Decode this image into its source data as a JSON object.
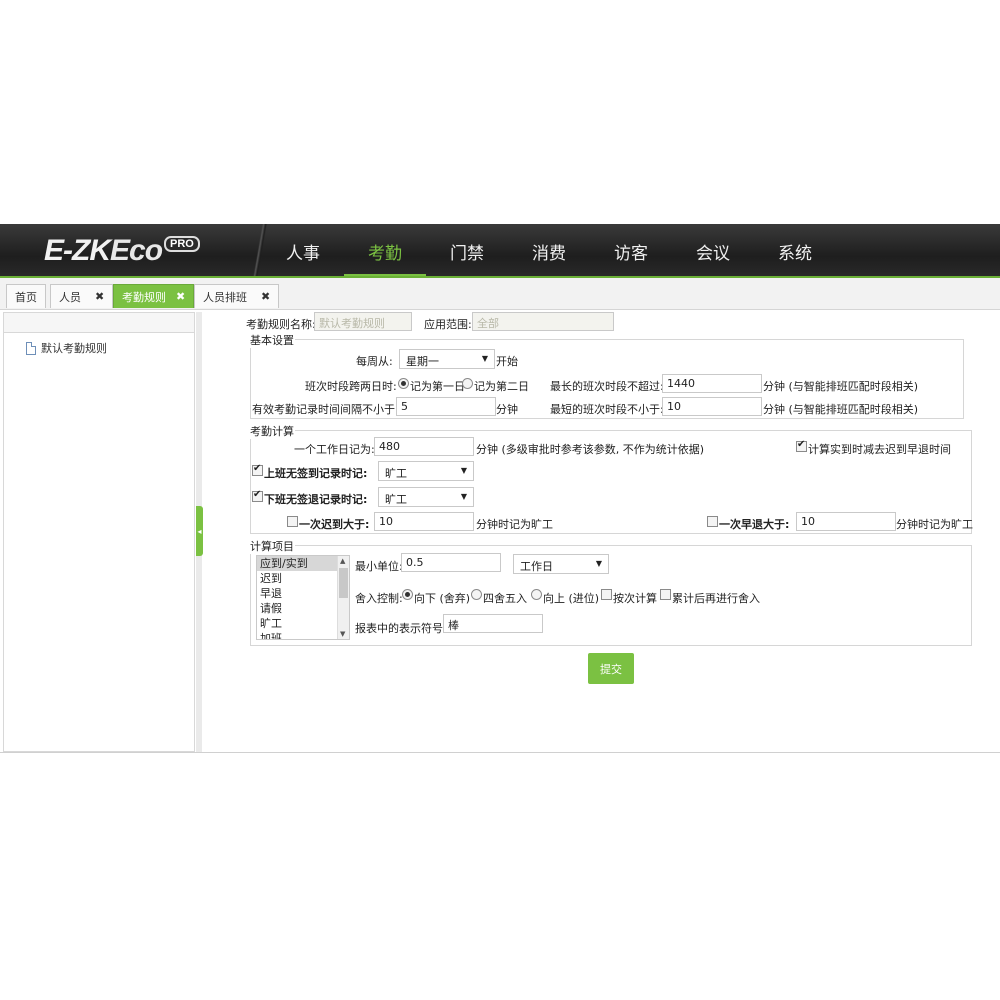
{
  "brand": {
    "logo_main": "E-ZK",
    "logo_eco": "Eco",
    "logo_badge": "PRO"
  },
  "nav": [
    "人事",
    "考勤",
    "门禁",
    "消费",
    "访客",
    "会议",
    "系统"
  ],
  "tabs": [
    {
      "label": "首页"
    },
    {
      "label": "人员",
      "close": "✖"
    },
    {
      "label": "考勤规则",
      "close": "✖"
    },
    {
      "label": "人员排班",
      "close": "✖"
    }
  ],
  "tree": {
    "node": "默认考勤规则"
  },
  "colors": {
    "accent": "#7bc142",
    "header_bg": "#2a2a2a"
  },
  "rule": {
    "name_label": "考勤规则名称:",
    "name_value": "默认考勤规则",
    "scope_label": "应用范围:",
    "scope_value": "全部"
  },
  "basic": {
    "legend": "基本设置",
    "week_label": "每周从:",
    "week_value": "星期一",
    "week_suffix": "开始",
    "cross_label": "班次时段跨两日时:",
    "cross_opt1": "记为第一日",
    "cross_opt2": "记为第二日",
    "maxshift_label": "最长的班次时段不超过:",
    "maxshift_value": "1440",
    "maxshift_suffix": "分钟 (与智能排班匹配时段相关)",
    "interval_label": "有效考勤记录时间间隔不小于:",
    "interval_value": "5",
    "interval_suffix": "分钟",
    "minshift_label": "最短的班次时段不小于:",
    "minshift_value": "10",
    "minshift_suffix": "分钟 (与智能排班匹配时段相关)"
  },
  "calc": {
    "legend": "考勤计算",
    "workday_label": "一个工作日记为:",
    "workday_value": "480",
    "workday_suffix": "分钟 (多级审批时参考该参数, 不作为统计依据)",
    "deduct_label": "计算实到时减去迟到早退时间",
    "nocheckin_label": "上班无签到记录时记:",
    "nocheckin_value": "旷工",
    "nocheckout_label": "下班无签退记录时记:",
    "nocheckout_value": "旷工",
    "late_label": "一次迟到大于:",
    "late_value": "10",
    "late_suffix": "分钟时记为旷工",
    "early_label": "一次早退大于:",
    "early_value": "10",
    "early_suffix": "分钟时记为旷工"
  },
  "items": {
    "legend": "计算项目",
    "list": [
      "应到/实到",
      "迟到",
      "早退",
      "请假",
      "旷工",
      "加班"
    ],
    "min_unit_label": "最小单位:",
    "min_unit_value": "0.5",
    "unit_select": "工作日",
    "round_label": "舍入控制:",
    "round_down": "向下 (舍弃)",
    "round_half": "四舍五入",
    "round_up": "向上 (进位)",
    "per_count": "按次计算",
    "accum": "累计后再进行舍入",
    "symbol_label": "报表中的表示符号:",
    "symbol_value": "棒"
  },
  "submit_label": "提交"
}
